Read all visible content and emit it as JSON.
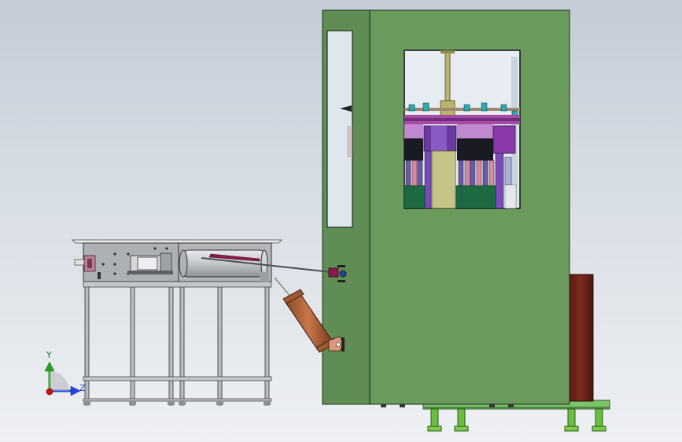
{
  "viewport": {
    "kind": "3d-cad-model-view",
    "background_top": "#c3ccd7",
    "background_bottom": "#eef0f3"
  },
  "colors": {
    "cabinet": "#6f9a5e",
    "cabinet_front": "#6a9b5d",
    "cabinet_side": "#5f8d53",
    "base_frame": "#7bc46b",
    "feet": "#6abf3f",
    "side_box": "#6a2217",
    "table_metal": "#b9bcbf",
    "drum": "#c5c8cb",
    "push_rod": "#8b1b4a",
    "cylinder": "#b86a3c",
    "axis_y": "#27a227",
    "axis_z": "#2244dd",
    "origin": "#cc1111"
  },
  "triad": {
    "y_label": "Y",
    "z_label": "Z",
    "icons": [
      "axis-y-arrow",
      "axis-z-arrow",
      "origin-dot"
    ]
  }
}
